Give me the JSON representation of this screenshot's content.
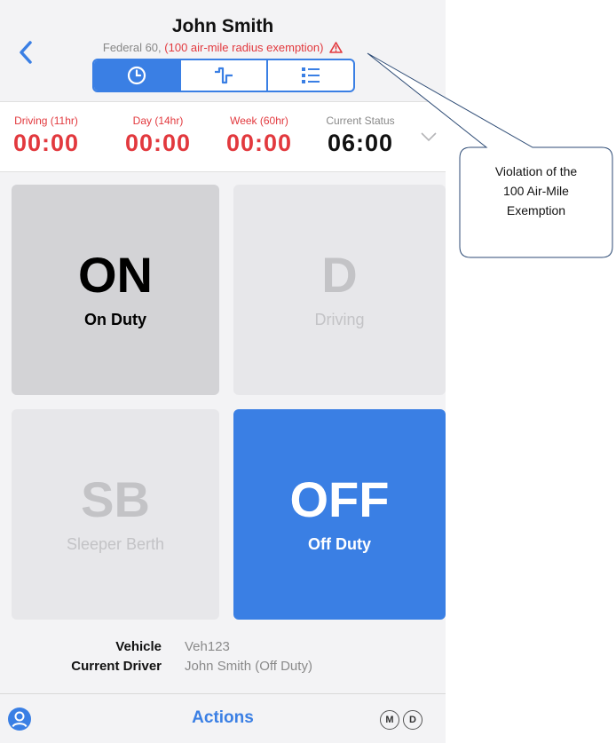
{
  "header": {
    "driver_name": "John Smith",
    "ruleset": "Federal 60,",
    "exemption": "(100 air-mile radius exemption)",
    "back_icon": "chevron-left-icon",
    "warning_icon": "warning-triangle-icon",
    "tabs": [
      {
        "icon": "clock-icon",
        "active": true
      },
      {
        "icon": "log-graph-icon",
        "active": false
      },
      {
        "icon": "list-icon",
        "active": false
      }
    ]
  },
  "timers": [
    {
      "label": "Driving (11hr)",
      "value": "00:00",
      "color": "#e2393e"
    },
    {
      "label": "Day (14hr)",
      "value": "00:00",
      "color": "#e2393e"
    },
    {
      "label": "Week (60hr)",
      "value": "00:00",
      "color": "#e2393e"
    },
    {
      "label": "Current Status",
      "value": "06:00",
      "color": "#111111"
    }
  ],
  "status_tiles": [
    {
      "code": "ON",
      "name": "On Duty",
      "state": "selected"
    },
    {
      "code": "D",
      "name": "Driving",
      "state": "disabled"
    },
    {
      "code": "SB",
      "name": "Sleeper Berth",
      "state": "disabled"
    },
    {
      "code": "OFF",
      "name": "Off Duty",
      "state": "current"
    }
  ],
  "info": {
    "vehicle_label": "Vehicle",
    "vehicle_value": "Veh123",
    "driver_label": "Current Driver",
    "driver_value": "John Smith (Off Duty)"
  },
  "bottom_bar": {
    "actions_label": "Actions",
    "profile_icon": "user-circle-icon",
    "m_label": "M",
    "d_label": "D"
  },
  "callout": {
    "lines": [
      "Violation of the",
      "100 Air-Mile",
      "Exemption"
    ]
  },
  "colors": {
    "accent": "#3a7fe4",
    "violation": "#e2393e",
    "background": "#f3f3f5"
  }
}
